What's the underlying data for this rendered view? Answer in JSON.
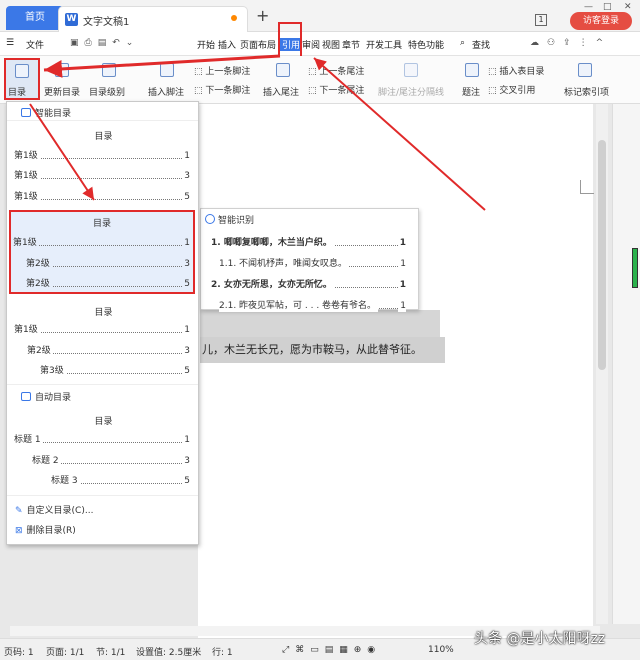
{
  "tabs": {
    "home": "首页",
    "doc": "文字文稿1",
    "plus": "+"
  },
  "titlebar": {
    "badge": "1",
    "login": "访客登录"
  },
  "menu": {
    "file": "文件",
    "items": [
      "开始",
      "插入",
      "页面布局",
      "引用",
      "审阅",
      "视图",
      "章节",
      "开发工具",
      "特色功能"
    ],
    "search": "查找"
  },
  "ribbon": {
    "toc": "目录",
    "update_toc": "更新目录",
    "toc_level": "目录级别",
    "insert_footnote": "插入脚注",
    "prev_footnote": "上一条脚注",
    "next_footnote": "下一条脚注",
    "insert_endnote": "插入尾注",
    "prev_endnote": "上一条尾注",
    "next_endnote": "下一条尾注",
    "sep": "脚注/尾注分隔线",
    "caption": "题注",
    "insert_table_toc": "插入表目录",
    "cross_ref": "交叉引用",
    "index": "标记索引项"
  },
  "dropdown": {
    "smart_header": "智能目录",
    "smart1": {
      "title": "目录",
      "rows": [
        {
          "l": "第1级",
          "p": "1"
        },
        {
          "l": "第1级",
          "p": "3"
        },
        {
          "l": "第1级",
          "p": "5"
        }
      ]
    },
    "smart2": {
      "title": "目录",
      "rows": [
        {
          "l": "第1级",
          "p": "1"
        },
        {
          "l": "第2级",
          "p": "3"
        },
        {
          "l": "第2级",
          "p": "5"
        }
      ]
    },
    "smart3": {
      "title": "目录",
      "rows": [
        {
          "l": "第1级",
          "p": "1"
        },
        {
          "l": "第2级",
          "p": "3"
        },
        {
          "l": "第3级",
          "p": "5"
        }
      ]
    },
    "auto_header": "自动目录",
    "auto": {
      "title": "目录",
      "rows": [
        {
          "l": "标题 1",
          "p": "1"
        },
        {
          "l": "标题 2",
          "p": "3"
        },
        {
          "l": "标题 3",
          "p": "5"
        }
      ]
    },
    "custom": "自定义目录(C)...",
    "delete": "删除目录(R)"
  },
  "smart_panel": {
    "header": "智能识别",
    "rows": [
      {
        "l": "1. 唧唧复唧唧，木兰当户织。",
        "p": "1"
      },
      {
        "l": "1.1. 不闻机杼声，唯闻女叹息。",
        "p": "1"
      },
      {
        "l": "2. 女亦无所思，女亦无所忆。",
        "p": "1"
      },
      {
        "l": "2.1. 昨夜见军帖，可 . . . 卷卷有爷名。",
        "p": "1"
      }
    ]
  },
  "body_text": "儿，木兰无长兄，愿为市鞍马，从此替爷征。",
  "status": {
    "page": "页码: 1",
    "pages": "页面: 1/1",
    "section": "节: 1/1",
    "setting": "设置值: 2.5厘米",
    "row": "行: 1",
    "zoom": "110%"
  },
  "watermark": "头条 @是小太阳呀zz",
  "colors": {
    "accent": "#3b78e7",
    "highlight": "#e02a2a"
  }
}
